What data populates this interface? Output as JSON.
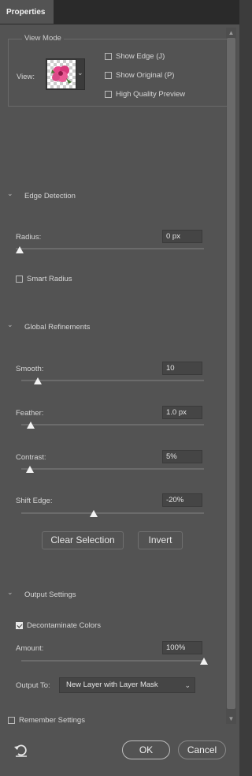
{
  "tab": {
    "title": "Properties"
  },
  "view_mode": {
    "legend": "View Mode",
    "view_label": "View:",
    "options": [
      {
        "label": "Show Edge (J)",
        "checked": false
      },
      {
        "label": "Show Original (P)",
        "checked": false
      },
      {
        "label": "High Quality Preview",
        "checked": false
      }
    ]
  },
  "edge_detection": {
    "title": "Edge Detection",
    "radius": {
      "label": "Radius:",
      "value": "0 px",
      "level": 0
    },
    "smart_radius": {
      "label": "Smart Radius",
      "checked": false
    }
  },
  "global_refinements": {
    "title": "Global Refinements",
    "smooth": {
      "label": "Smooth:",
      "value": "10",
      "level": 0.1
    },
    "feather": {
      "label": "Feather:",
      "value": "1.0 px",
      "level": 0.04
    },
    "contrast": {
      "label": "Contrast:",
      "value": "5%",
      "level": 0.05
    },
    "shift_edge": {
      "label": "Shift Edge:",
      "value": "-20%",
      "level": 0.4
    },
    "clear_selection": "Clear Selection",
    "invert": "Invert"
  },
  "output_settings": {
    "title": "Output Settings",
    "decontaminate": {
      "label": "Decontaminate Colors",
      "checked": true
    },
    "amount": {
      "label": "Amount:",
      "value": "100%",
      "level": 1.0
    },
    "output_to": {
      "label": "Output To:",
      "selected": "New Layer with Layer Mask"
    }
  },
  "remember": {
    "label": "Remember Settings",
    "checked": false
  },
  "footer": {
    "ok": "OK",
    "cancel": "Cancel"
  },
  "icons": {
    "section_chevron": "chevron-down-icon",
    "reset": "reset-icon",
    "view_caret": "chevron-down-icon",
    "scroll_up": "scroll-up-arrow-icon",
    "scroll_down": "scroll-down-arrow-icon"
  }
}
